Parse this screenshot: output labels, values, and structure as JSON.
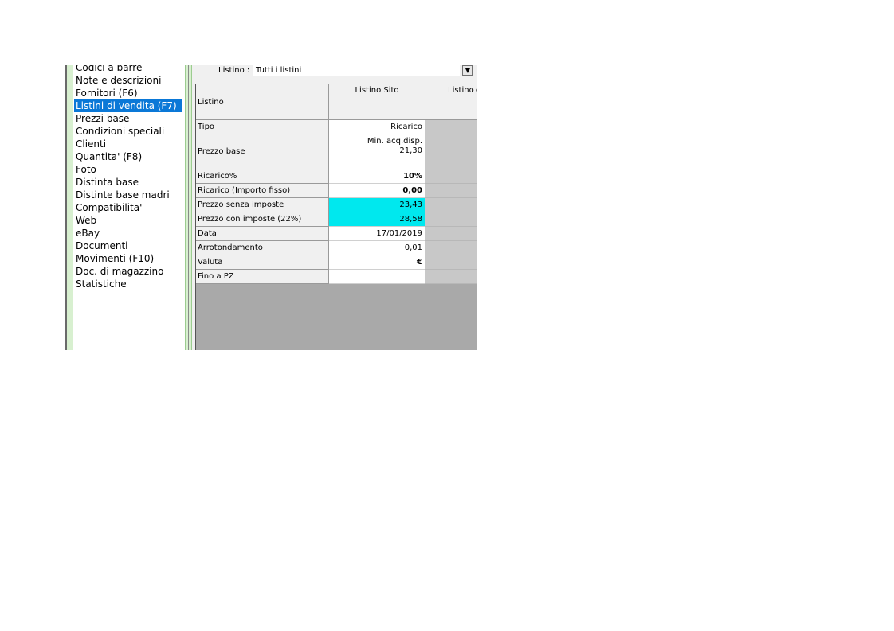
{
  "nav": {
    "items": [
      {
        "label": "Codici a barre",
        "selected": false
      },
      {
        "label": "Note e descrizioni",
        "selected": false
      },
      {
        "label": "Fornitori (F6)",
        "selected": false
      },
      {
        "label": "Listini di vendita (F7)",
        "selected": true
      },
      {
        "label": "Prezzi base",
        "selected": false
      },
      {
        "label": "Condizioni speciali",
        "selected": false
      },
      {
        "label": "Clienti",
        "selected": false
      },
      {
        "label": "Quantita' (F8)",
        "selected": false
      },
      {
        "label": "Foto",
        "selected": false
      },
      {
        "label": "Distinta base",
        "selected": false
      },
      {
        "label": "Distinte base madri",
        "selected": false
      },
      {
        "label": "Compatibilita'",
        "selected": false
      },
      {
        "label": "Web",
        "selected": false
      },
      {
        "label": "eBay",
        "selected": false
      },
      {
        "label": "Documenti",
        "selected": false
      },
      {
        "label": "Movimenti (F10)",
        "selected": false
      },
      {
        "label": "Doc. di magazzino",
        "selected": false
      },
      {
        "label": "Statistiche",
        "selected": false
      }
    ]
  },
  "filter": {
    "label": "Listino :",
    "value": "Tutti i listini",
    "dropdown_icon": "triangle-down"
  },
  "table": {
    "header": {
      "label": "Listino",
      "col1": "Listino Sito",
      "col2": "Listino e"
    },
    "rows": [
      {
        "label": "Tipo",
        "value": "Ricarico"
      },
      {
        "label": "Prezzo base",
        "value": "Min. acq.disp.",
        "value2": "21,30"
      },
      {
        "label": "Ricarico%",
        "value": "10%"
      },
      {
        "label": "Ricarico (Importo fisso)",
        "value": "0,00"
      },
      {
        "label": "Prezzo senza imposte",
        "value": "23,43"
      },
      {
        "label": "Prezzo con imposte (22%)",
        "value": "28,58"
      },
      {
        "label": "Data",
        "value": "17/01/2019"
      },
      {
        "label": "Arrotondamento",
        "value": "0,01"
      },
      {
        "label": "Valuta",
        "value": "€"
      },
      {
        "label": "Fino a PZ",
        "value": ""
      }
    ]
  },
  "colors": {
    "selection": "#0a78d7",
    "highlight": "#00e8ee",
    "grid_background": "#a9a9a9"
  }
}
